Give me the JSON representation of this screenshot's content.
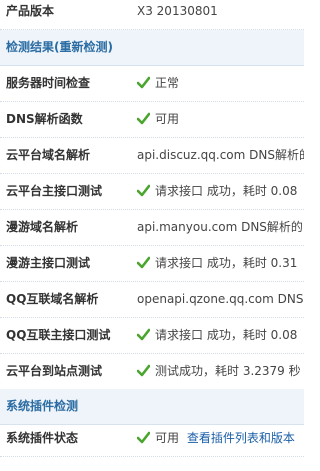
{
  "rows": {
    "product_version": {
      "label": "产品版本",
      "value": "X3 20130801"
    },
    "section_check": {
      "label": "检测结果(重新检测)"
    },
    "server_time": {
      "label": "服务器时间检查",
      "value": "正常",
      "icon": "check-icon"
    },
    "dns_func": {
      "label": "DNS解析函数",
      "value": "可用",
      "icon": "check-icon"
    },
    "cloud_domain": {
      "label": "云平台域名解析",
      "value": "api.discuz.qq.com DNS解析的"
    },
    "cloud_api": {
      "label": "云平台主接口测试",
      "value": "请求接口 成功，耗时 0.08",
      "icon": "check-icon"
    },
    "manyou_domain": {
      "label": "漫游域名解析",
      "value": "api.manyou.com DNS解析的"
    },
    "manyou_api": {
      "label": "漫游主接口测试",
      "value": "请求接口 成功，耗时 0.31",
      "icon": "check-icon"
    },
    "qq_domain": {
      "label": "QQ互联域名解析",
      "value": "openapi.qzone.qq.com DNS"
    },
    "qq_api": {
      "label": "QQ互联主接口测试",
      "value": "请求接口 成功，耗时 0.08",
      "icon": "check-icon"
    },
    "cloud_site": {
      "label": "云平台到站点测试",
      "value": "测试成功，耗时 3.2379 秒",
      "icon": "check-icon"
    },
    "section_plugin": {
      "label": "系统插件检测"
    },
    "plugin_status": {
      "label": "系统插件状态",
      "value": "可用",
      "link": "查看插件列表和版本",
      "icon": "check-icon"
    }
  },
  "colors": {
    "section_bg": "#eef4fa",
    "section_text": "#2b6ca3",
    "check": "#4aa52e",
    "link": "#1b5fa7"
  }
}
